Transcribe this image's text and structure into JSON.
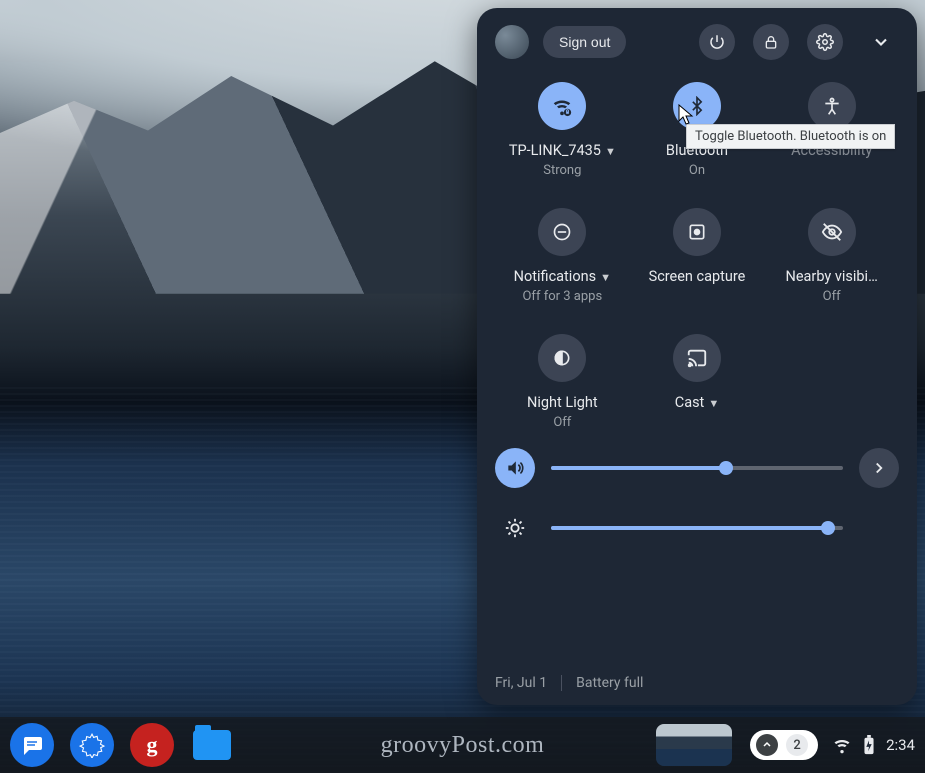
{
  "header": {
    "signout_label": "Sign out"
  },
  "tiles": {
    "wifi": {
      "label": "TP-LINK_7435",
      "sub": "Strong",
      "has_caret": true
    },
    "bluetooth": {
      "label": "Bluetooth",
      "sub": "On",
      "tooltip": "Toggle Bluetooth. Bluetooth is on"
    },
    "accessibility": {
      "label": "Accessibility",
      "sub": ""
    },
    "notifications": {
      "label": "Notifications",
      "sub": "Off for 3 apps",
      "has_caret": true
    },
    "screencapture": {
      "label": "Screen capture",
      "sub": ""
    },
    "nearby": {
      "label": "Nearby visibi…",
      "sub": "Off"
    },
    "nightlight": {
      "label": "Night Light",
      "sub": "Off"
    },
    "cast": {
      "label": "Cast",
      "sub": "",
      "has_caret": true
    }
  },
  "sliders": {
    "volume_percent": 60,
    "brightness_percent": 95
  },
  "footer": {
    "date": "Fri, Jul 1",
    "battery": "Battery full"
  },
  "shelf": {
    "watermark": "groovyPost.com",
    "notification_count": "2",
    "clock": "2:34"
  }
}
